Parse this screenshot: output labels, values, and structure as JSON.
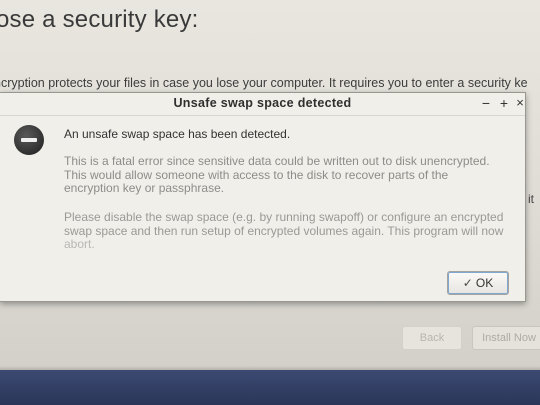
{
  "installer": {
    "title": "ose a security key:",
    "description": "ncryption protects your files in case you lose your computer. It requires you to enter a security ke",
    "side_text": "it",
    "back_label": "Back",
    "install_label": "Install Now"
  },
  "dialog": {
    "title": "Unsafe swap space detected",
    "controls": {
      "minimize": "−",
      "maximize": "+",
      "close": "×"
    },
    "message": "An unsafe swap space has been detected.",
    "detail_line1": "This is a fatal error since sensitive data could be written out to disk unencrypted.",
    "detail_line2": "This would allow someone with access to the disk to recover parts of the",
    "detail_line3": "encryption key or passphrase.",
    "advice_line1": "Please disable the swap space (e.g. by running swapoff) or configure an encrypted",
    "advice_line2": "swap space and then run setup of encrypted volumes again. This program will now",
    "advice_line3": "abort.",
    "ok_label": "OK",
    "ok_icon": "checkmark-icon",
    "error_icon": "error-icon"
  }
}
